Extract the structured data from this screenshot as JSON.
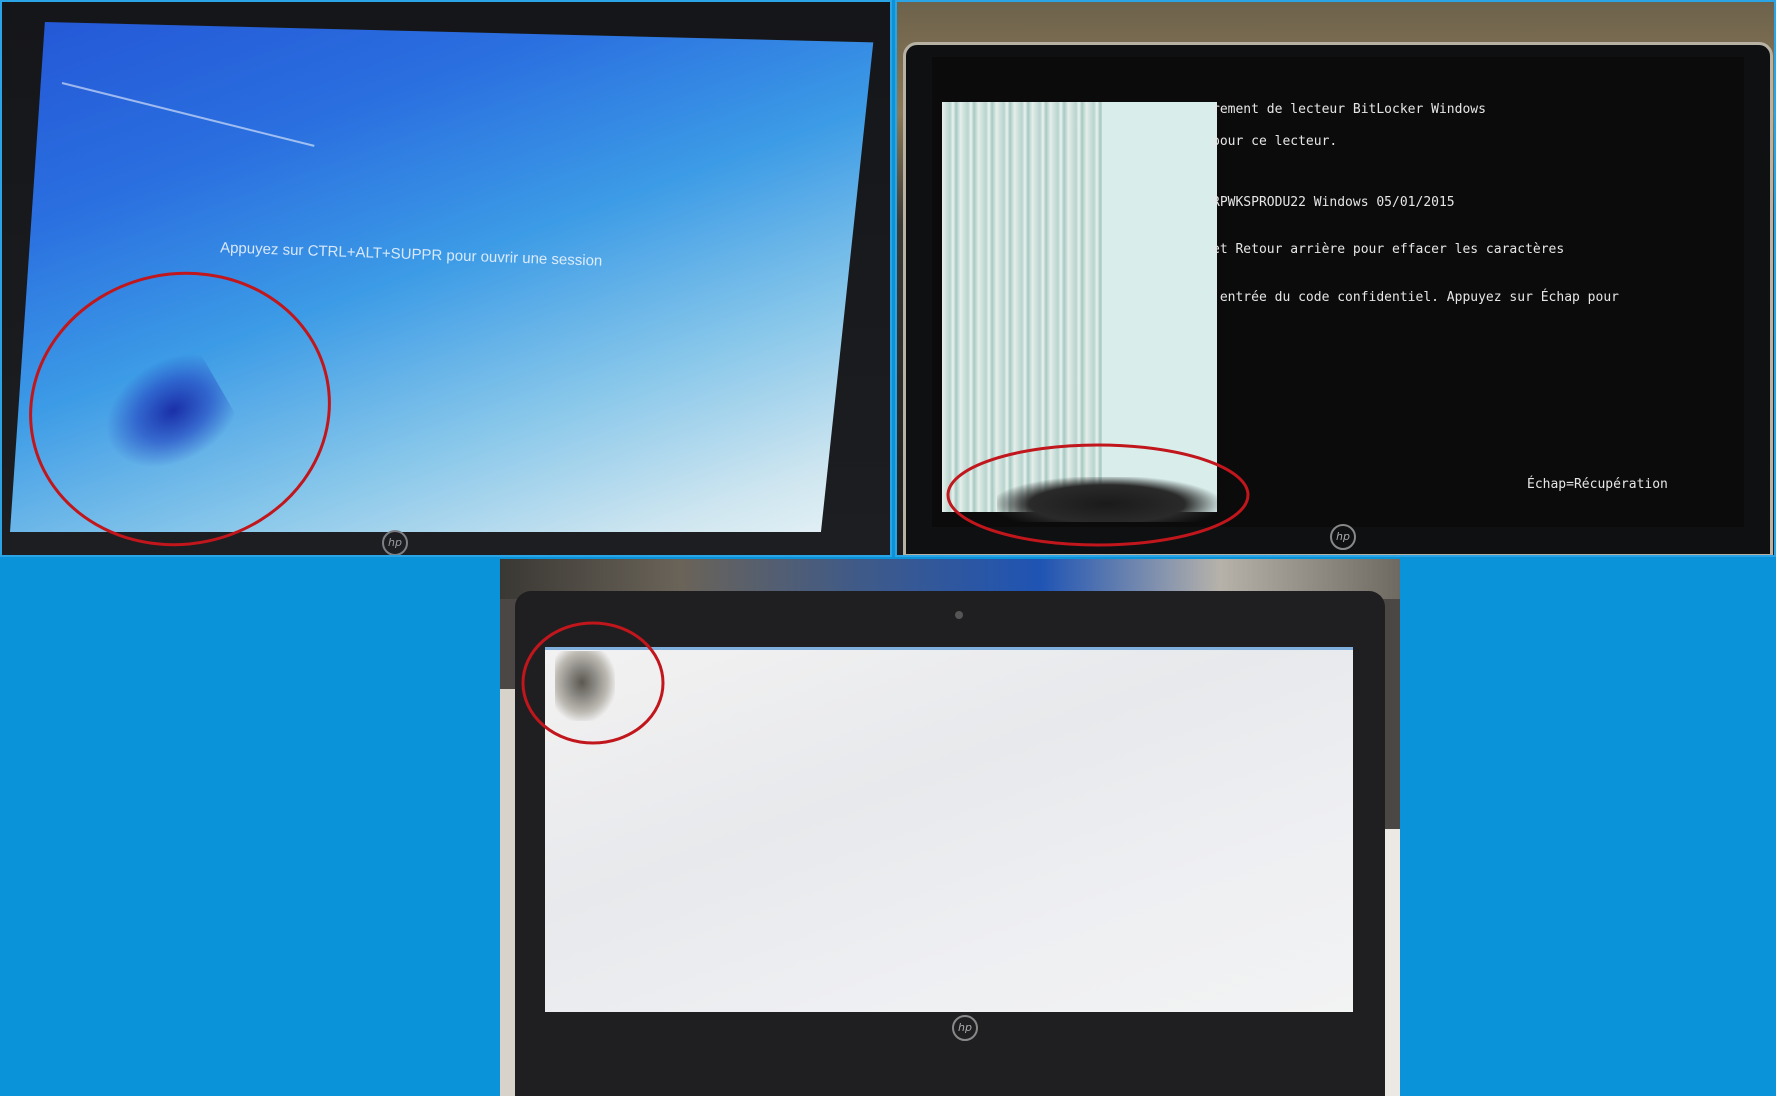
{
  "panels": [
    {
      "id": "lock-screen",
      "screen_text": "Appuyez sur CTRL+ALT+SUPPR pour ouvrir une session",
      "logo": "hp"
    },
    {
      "id": "bitlocker",
      "lines": [
        "rement de lecteur BitLocker Windows",
        "pour ce lecteur.",
        "RPWKSPRODU22 Windows 05/01/2015",
        "et Retour arrière pour effacer les caractères",
        "'entrée du code confidentiel. Appuyez sur Échap pour"
      ],
      "bottom_right": "Échap=Récupération",
      "logo": "hp"
    },
    {
      "id": "blank-screen",
      "logo": "hp"
    }
  ],
  "colors": {
    "background": "#0a93d8",
    "highlight_circle": "#c0161c"
  }
}
